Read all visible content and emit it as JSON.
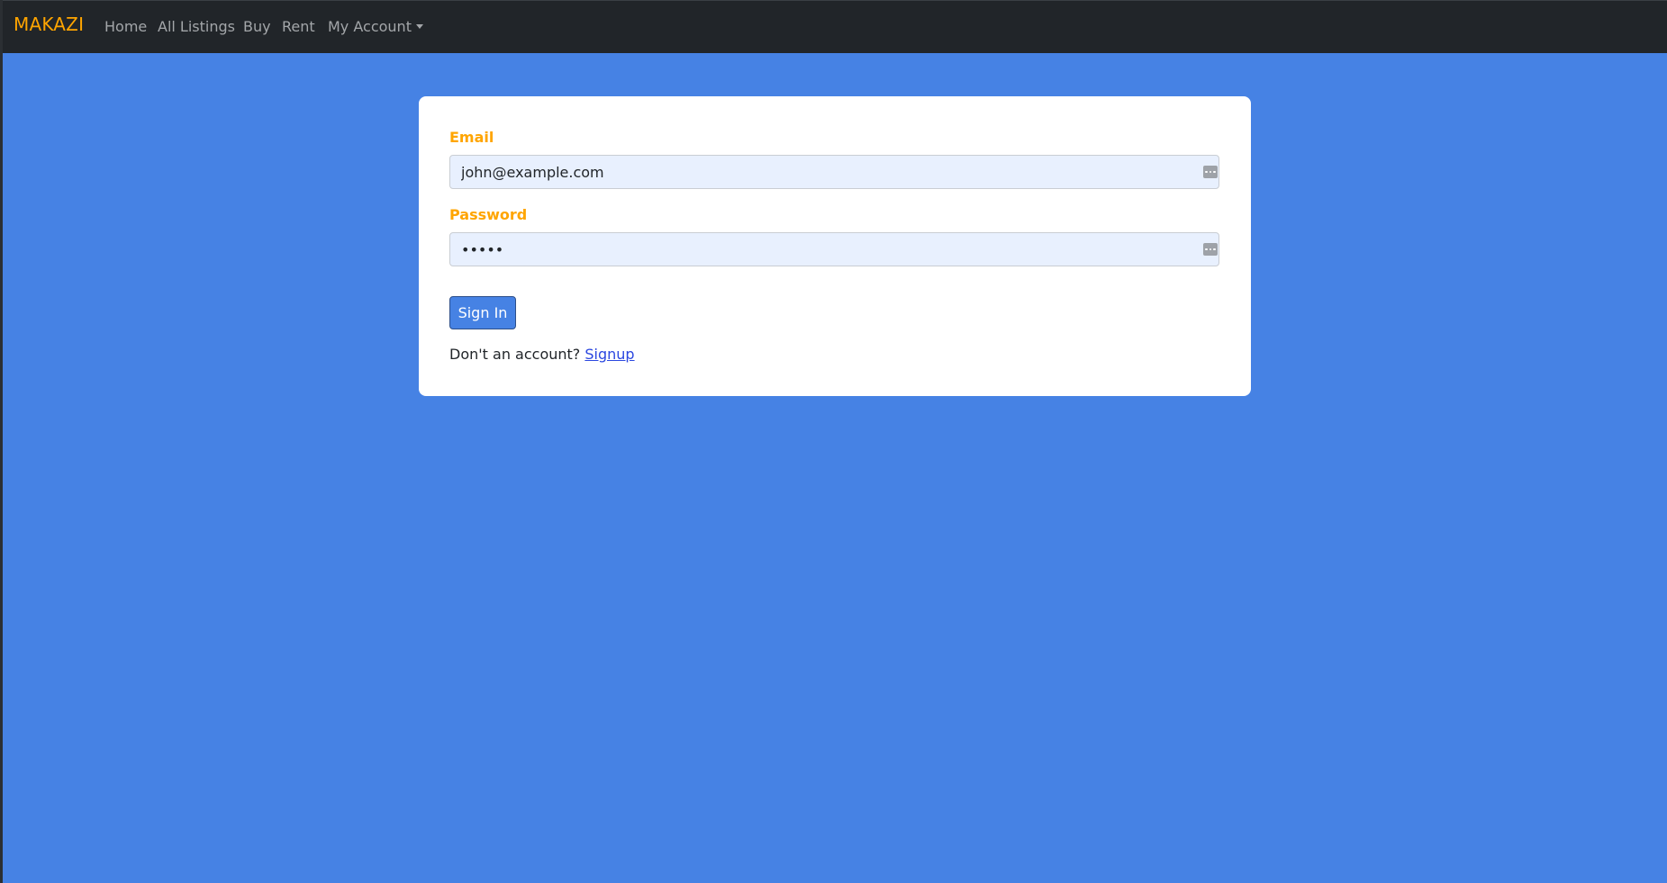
{
  "navbar": {
    "brand": "MAKAZI",
    "links": [
      {
        "label": "Home"
      },
      {
        "label": "All Listings"
      },
      {
        "label": "Buy"
      },
      {
        "label": "Rent"
      }
    ],
    "account_dropdown": {
      "label": "My Account"
    }
  },
  "login_form": {
    "email_label": "Email",
    "email_value": "john@example.com",
    "password_label": "Password",
    "password_value": "•••••",
    "submit_label": "Sign In",
    "signup_prompt": "Don't an account?",
    "signup_link": "Signup"
  },
  "colors": {
    "navbar_bg": "#212529",
    "brand": "#ffa500",
    "page_bg": "#4682e4",
    "label": "#ffa500",
    "input_bg": "#e8f0fe",
    "button_bg": "#4682e4",
    "link": "#2b47e0"
  },
  "icons": {
    "field_helper": "password-manager-icon",
    "dropdown": "caret-down-icon"
  }
}
